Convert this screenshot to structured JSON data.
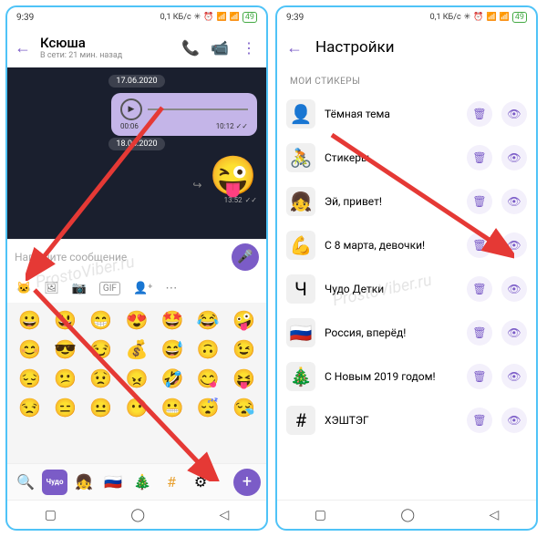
{
  "status": {
    "time": "9:39",
    "net": "0,1 КБ/с"
  },
  "left": {
    "contact": "Ксюша",
    "last_seen": "В сети: 21 мин. назад",
    "date1": "17.06.2020",
    "date2": "18.06.2020",
    "voice": {
      "start": "00:06",
      "end": "10:12"
    },
    "sticker_time": "13:52",
    "input_placeholder": "Напишите сообщение",
    "gif_label": "GIF",
    "emojis": [
      "😀",
      "😃",
      "😁",
      "😍",
      "🤩",
      "😂",
      "🤪",
      "😊",
      "😎",
      "😏",
      "💰",
      "😅",
      "🙃",
      "😉",
      "😔",
      "😕",
      "😟",
      "😠",
      "🤣",
      "😋",
      "😝",
      "😒",
      "😑",
      "😐",
      "😶",
      "😬",
      "😴",
      "😪"
    ]
  },
  "right": {
    "title": "Настройки",
    "section": "МОИ СТИКЕРЫ",
    "packs": [
      {
        "name": "Тёмная тема",
        "thumb": "👤"
      },
      {
        "name": "Стикеры",
        "thumb": "🚴"
      },
      {
        "name": "Эй, привет!",
        "thumb": "👧"
      },
      {
        "name": "С 8 марта, девочки!",
        "thumb": "💪"
      },
      {
        "name": "Чудо Детки",
        "thumb": "Ч"
      },
      {
        "name": "Россия, вперёд!",
        "thumb": "🇷🇺"
      },
      {
        "name": "С Новым 2019 годом!",
        "thumb": "🎄"
      },
      {
        "name": "ХЭШТЭГ",
        "thumb": "#"
      }
    ]
  },
  "watermark": "ProstoViber.ru"
}
